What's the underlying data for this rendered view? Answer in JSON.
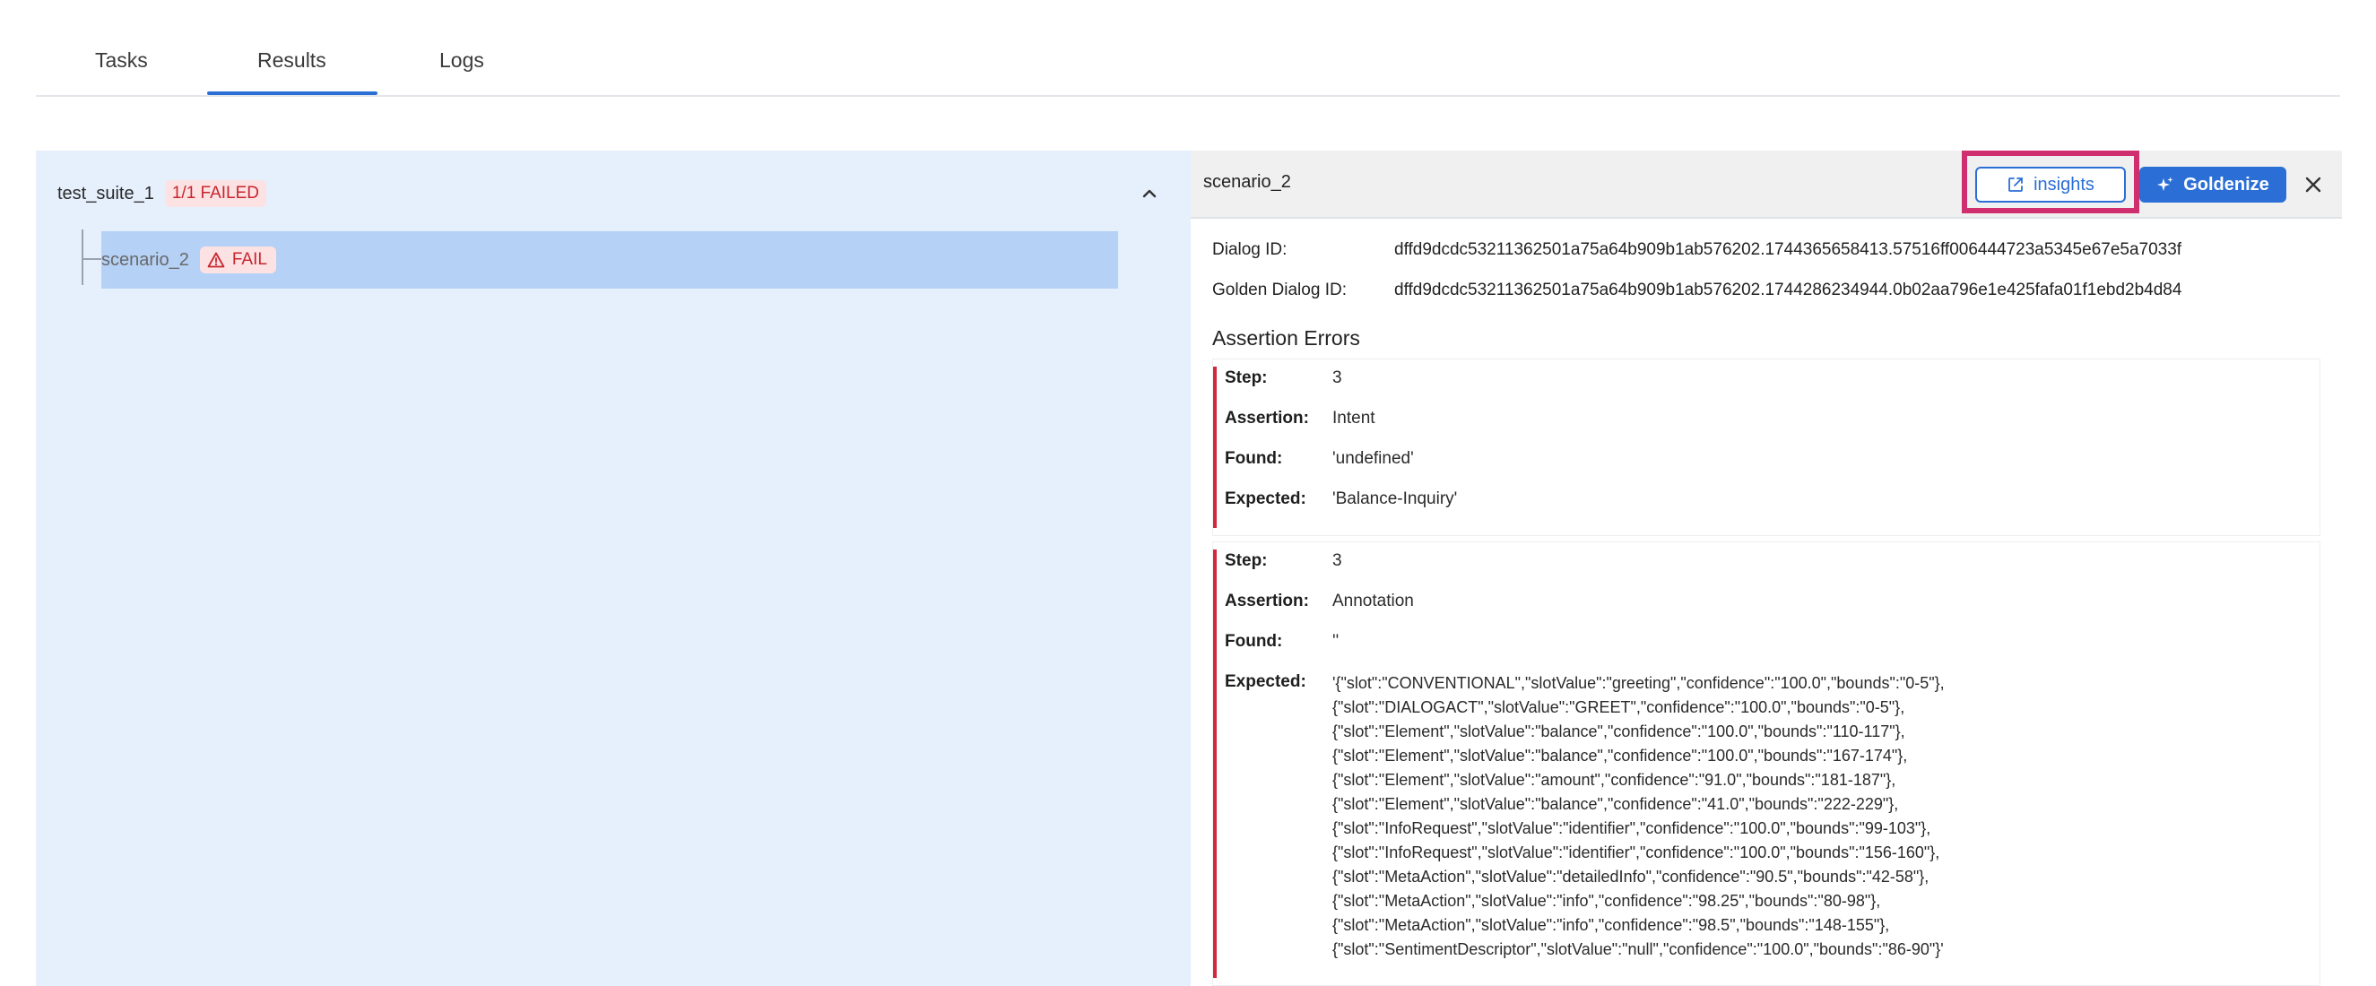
{
  "tabs": [
    {
      "label": "Tasks"
    },
    {
      "label": "Results"
    },
    {
      "label": "Logs"
    }
  ],
  "active_tab": "Results",
  "colors": {
    "accent": "#2b6fd6",
    "fail": "#c6262e",
    "highlight": "#cf2f6e"
  },
  "suite": {
    "name": "test_suite_1",
    "badge": "1/1 FAILED",
    "collapse_icon": "chevron-up-icon",
    "scenarios": [
      {
        "name": "scenario_2",
        "status": "FAIL",
        "status_icon": "warning-icon"
      }
    ]
  },
  "detail": {
    "title": "scenario_2",
    "insights_label": "insights",
    "goldenize_label": "Goldenize",
    "dialog_id_label": "Dialog ID:",
    "dialog_id": "dffd9dcdc53211362501a75a64b909b1ab576202.1744365658413.57516ff006444723a5345e67e5a7033f",
    "golden_dialog_id_label": "Golden Dialog ID:",
    "golden_dialog_id": "dffd9dcdc53211362501a75a64b909b1ab576202.1744286234944.0b02aa796e1e425fafa01f1ebd2b4d84",
    "assertion_errors_title": "Assertion Errors",
    "labels": {
      "step": "Step:",
      "assertion": "Assertion:",
      "found": "Found:",
      "expected": "Expected:"
    },
    "errors": [
      {
        "step": "3",
        "assertion": "Intent",
        "found": "'undefined'",
        "expected": "'Balance-Inquiry'"
      },
      {
        "step": "3",
        "assertion": "Annotation",
        "found": "''",
        "expected_lines": [
          "'{\"slot\":\"CONVENTIONAL\",\"slotValue\":\"greeting\",\"confidence\":\"100.0\",\"bounds\":\"0-5\"},",
          "{\"slot\":\"DIALOGACT\",\"slotValue\":\"GREET\",\"confidence\":\"100.0\",\"bounds\":\"0-5\"},",
          "{\"slot\":\"Element\",\"slotValue\":\"balance\",\"confidence\":\"100.0\",\"bounds\":\"110-117\"},",
          "{\"slot\":\"Element\",\"slotValue\":\"balance\",\"confidence\":\"100.0\",\"bounds\":\"167-174\"},",
          "{\"slot\":\"Element\",\"slotValue\":\"amount\",\"confidence\":\"91.0\",\"bounds\":\"181-187\"},",
          "{\"slot\":\"Element\",\"slotValue\":\"balance\",\"confidence\":\"41.0\",\"bounds\":\"222-229\"},",
          "{\"slot\":\"InfoRequest\",\"slotValue\":\"identifier\",\"confidence\":\"100.0\",\"bounds\":\"99-103\"},",
          "{\"slot\":\"InfoRequest\",\"slotValue\":\"identifier\",\"confidence\":\"100.0\",\"bounds\":\"156-160\"},",
          "{\"slot\":\"MetaAction\",\"slotValue\":\"detailedInfo\",\"confidence\":\"90.5\",\"bounds\":\"42-58\"},",
          "{\"slot\":\"MetaAction\",\"slotValue\":\"info\",\"confidence\":\"98.25\",\"bounds\":\"80-98\"},",
          "{\"slot\":\"MetaAction\",\"slotValue\":\"info\",\"confidence\":\"98.5\",\"bounds\":\"148-155\"},",
          "{\"slot\":\"SentimentDescriptor\",\"slotValue\":\"null\",\"confidence\":\"100.0\",\"bounds\":\"86-90\"}'"
        ]
      }
    ]
  }
}
